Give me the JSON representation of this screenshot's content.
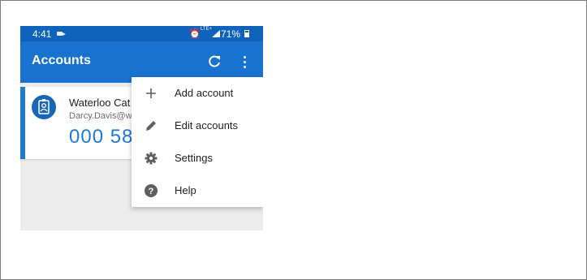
{
  "status_bar": {
    "time": "4:41",
    "battery_percent": "71%",
    "network_label": "LTE+"
  },
  "app_bar": {
    "title": "Accounts",
    "refresh_icon": "refresh-icon",
    "overflow_icon": "more-vert-icon"
  },
  "account": {
    "name": "Waterloo Cat",
    "email": "Darcy.Davis@w",
    "code": "000 58",
    "avatar_icon": "badge-icon"
  },
  "menu": {
    "items": [
      {
        "label": "Add account",
        "icon": "plus-icon"
      },
      {
        "label": "Edit accounts",
        "icon": "pencil-icon"
      },
      {
        "label": "Settings",
        "icon": "gear-icon"
      },
      {
        "label": "Help",
        "icon": "help-icon"
      }
    ]
  },
  "colors": {
    "status_bar": "#0f63bd",
    "app_bar": "#1773cf",
    "accent": "#1e7ad6",
    "menu_icon": "#5f5f5f"
  }
}
